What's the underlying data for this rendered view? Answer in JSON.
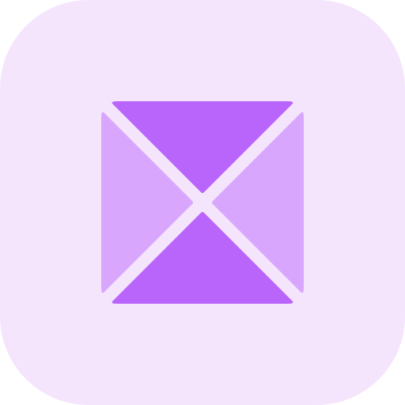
{
  "icon": {
    "name": "split-square-icon",
    "colors": {
      "background": "#f4e5fd",
      "dark_triangle": "#b965fc",
      "light_triangle": "#d9a6fd"
    }
  }
}
